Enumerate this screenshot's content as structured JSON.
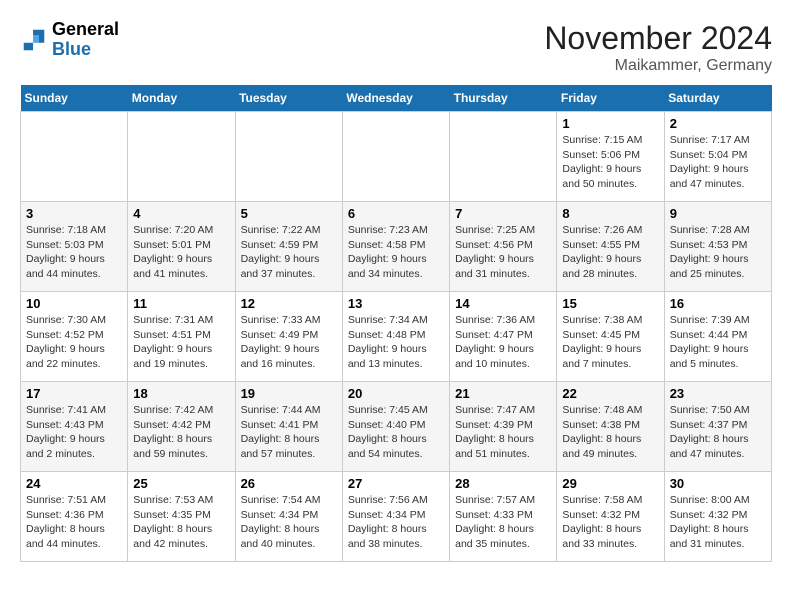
{
  "header": {
    "logo": {
      "general": "General",
      "blue": "Blue"
    },
    "title": "November 2024",
    "subtitle": "Maikammer, Germany"
  },
  "days_of_week": [
    "Sunday",
    "Monday",
    "Tuesday",
    "Wednesday",
    "Thursday",
    "Friday",
    "Saturday"
  ],
  "weeks": [
    [
      {
        "day": "",
        "info": ""
      },
      {
        "day": "",
        "info": ""
      },
      {
        "day": "",
        "info": ""
      },
      {
        "day": "",
        "info": ""
      },
      {
        "day": "",
        "info": ""
      },
      {
        "day": "1",
        "info": "Sunrise: 7:15 AM\nSunset: 5:06 PM\nDaylight: 9 hours and 50 minutes."
      },
      {
        "day": "2",
        "info": "Sunrise: 7:17 AM\nSunset: 5:04 PM\nDaylight: 9 hours and 47 minutes."
      }
    ],
    [
      {
        "day": "3",
        "info": "Sunrise: 7:18 AM\nSunset: 5:03 PM\nDaylight: 9 hours and 44 minutes."
      },
      {
        "day": "4",
        "info": "Sunrise: 7:20 AM\nSunset: 5:01 PM\nDaylight: 9 hours and 41 minutes."
      },
      {
        "day": "5",
        "info": "Sunrise: 7:22 AM\nSunset: 4:59 PM\nDaylight: 9 hours and 37 minutes."
      },
      {
        "day": "6",
        "info": "Sunrise: 7:23 AM\nSunset: 4:58 PM\nDaylight: 9 hours and 34 minutes."
      },
      {
        "day": "7",
        "info": "Sunrise: 7:25 AM\nSunset: 4:56 PM\nDaylight: 9 hours and 31 minutes."
      },
      {
        "day": "8",
        "info": "Sunrise: 7:26 AM\nSunset: 4:55 PM\nDaylight: 9 hours and 28 minutes."
      },
      {
        "day": "9",
        "info": "Sunrise: 7:28 AM\nSunset: 4:53 PM\nDaylight: 9 hours and 25 minutes."
      }
    ],
    [
      {
        "day": "10",
        "info": "Sunrise: 7:30 AM\nSunset: 4:52 PM\nDaylight: 9 hours and 22 minutes."
      },
      {
        "day": "11",
        "info": "Sunrise: 7:31 AM\nSunset: 4:51 PM\nDaylight: 9 hours and 19 minutes."
      },
      {
        "day": "12",
        "info": "Sunrise: 7:33 AM\nSunset: 4:49 PM\nDaylight: 9 hours and 16 minutes."
      },
      {
        "day": "13",
        "info": "Sunrise: 7:34 AM\nSunset: 4:48 PM\nDaylight: 9 hours and 13 minutes."
      },
      {
        "day": "14",
        "info": "Sunrise: 7:36 AM\nSunset: 4:47 PM\nDaylight: 9 hours and 10 minutes."
      },
      {
        "day": "15",
        "info": "Sunrise: 7:38 AM\nSunset: 4:45 PM\nDaylight: 9 hours and 7 minutes."
      },
      {
        "day": "16",
        "info": "Sunrise: 7:39 AM\nSunset: 4:44 PM\nDaylight: 9 hours and 5 minutes."
      }
    ],
    [
      {
        "day": "17",
        "info": "Sunrise: 7:41 AM\nSunset: 4:43 PM\nDaylight: 9 hours and 2 minutes."
      },
      {
        "day": "18",
        "info": "Sunrise: 7:42 AM\nSunset: 4:42 PM\nDaylight: 8 hours and 59 minutes."
      },
      {
        "day": "19",
        "info": "Sunrise: 7:44 AM\nSunset: 4:41 PM\nDaylight: 8 hours and 57 minutes."
      },
      {
        "day": "20",
        "info": "Sunrise: 7:45 AM\nSunset: 4:40 PM\nDaylight: 8 hours and 54 minutes."
      },
      {
        "day": "21",
        "info": "Sunrise: 7:47 AM\nSunset: 4:39 PM\nDaylight: 8 hours and 51 minutes."
      },
      {
        "day": "22",
        "info": "Sunrise: 7:48 AM\nSunset: 4:38 PM\nDaylight: 8 hours and 49 minutes."
      },
      {
        "day": "23",
        "info": "Sunrise: 7:50 AM\nSunset: 4:37 PM\nDaylight: 8 hours and 47 minutes."
      }
    ],
    [
      {
        "day": "24",
        "info": "Sunrise: 7:51 AM\nSunset: 4:36 PM\nDaylight: 8 hours and 44 minutes."
      },
      {
        "day": "25",
        "info": "Sunrise: 7:53 AM\nSunset: 4:35 PM\nDaylight: 8 hours and 42 minutes."
      },
      {
        "day": "26",
        "info": "Sunrise: 7:54 AM\nSunset: 4:34 PM\nDaylight: 8 hours and 40 minutes."
      },
      {
        "day": "27",
        "info": "Sunrise: 7:56 AM\nSunset: 4:34 PM\nDaylight: 8 hours and 38 minutes."
      },
      {
        "day": "28",
        "info": "Sunrise: 7:57 AM\nSunset: 4:33 PM\nDaylight: 8 hours and 35 minutes."
      },
      {
        "day": "29",
        "info": "Sunrise: 7:58 AM\nSunset: 4:32 PM\nDaylight: 8 hours and 33 minutes."
      },
      {
        "day": "30",
        "info": "Sunrise: 8:00 AM\nSunset: 4:32 PM\nDaylight: 8 hours and 31 minutes."
      }
    ]
  ]
}
